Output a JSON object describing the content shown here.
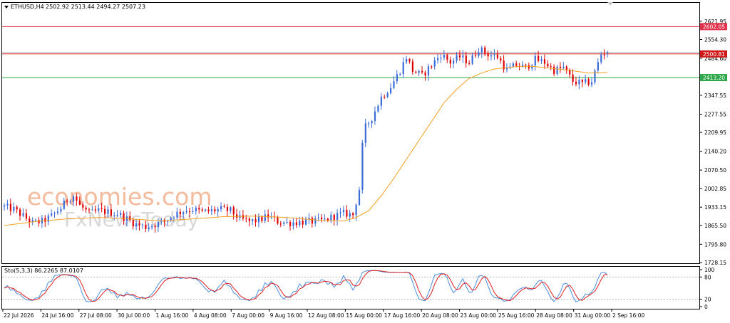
{
  "header": {
    "symbol": "ETHUSD,H4",
    "ohlc": "2502.92 2513.44 2494.27 2507.23",
    "oscillator": "Sto(5,3,3) 86.2265 87.0107"
  },
  "watermark": {
    "line1": "economies.com",
    "line2": "FxNewsToday"
  },
  "colors": {
    "bull": "#3a6cd8",
    "bear": "#e00000",
    "ma": "#f5a020",
    "resistance": "#e0304a",
    "support": "#2ea84a",
    "current": "#d01818",
    "stoch_main": "#4a90e2",
    "stoch_signal": "#e02020",
    "grid_dash": "#b0b0b0"
  },
  "chart_data": [
    {
      "type": "candlestick",
      "title": "ETHUSD,H4",
      "ylim": [
        1728.15,
        2690
      ],
      "y_ticks": [
        "2621.95",
        "2554.30",
        "2484.60",
        "2417.65",
        "2347.55",
        "2277.55",
        "2209.95",
        "2140.20",
        "2070.50",
        "2002.85",
        "1933.15",
        "1865.50",
        "1795.80",
        "1728.15"
      ],
      "x_ticks": [
        "22 Jul 2026",
        "24 Jul 16:00",
        "27 Jul 08:00",
        "30 Jul 00:00",
        "1 Aug 16:00",
        "4 Aug 08:00",
        "7 Aug 00:00",
        "9 Aug 16:00",
        "12 Aug 08:00",
        "15 Aug 00:00",
        "17 Aug 16:00",
        "20 Aug 08:00",
        "23 Aug 00:00",
        "25 Aug 16:00",
        "28 Aug 08:00",
        "31 Aug 00:00",
        "2 Sep 16:00"
      ],
      "levels": [
        {
          "name": "resistance",
          "value": 2602.05,
          "label": "2602.05"
        },
        {
          "name": "current",
          "value": 2500.81,
          "label": "2500.81"
        },
        {
          "name": "support",
          "value": 2413.2,
          "label": "2413.20"
        }
      ],
      "close_keypoints": [
        [
          0,
          1935
        ],
        [
          3,
          1925
        ],
        [
          6,
          1900
        ],
        [
          9,
          1875
        ],
        [
          12,
          1880
        ],
        [
          15,
          1900
        ],
        [
          18,
          1930
        ],
        [
          20,
          1960
        ],
        [
          22,
          1975
        ],
        [
          24,
          1940
        ],
        [
          27,
          1910
        ],
        [
          30,
          1920
        ],
        [
          33,
          1915
        ],
        [
          36,
          1910
        ],
        [
          39,
          1890
        ],
        [
          42,
          1870
        ],
        [
          45,
          1860
        ],
        [
          48,
          1870
        ],
        [
          51,
          1880
        ],
        [
          54,
          1905
        ],
        [
          57,
          1920
        ],
        [
          60,
          1925
        ],
        [
          63,
          1915
        ],
        [
          66,
          1920
        ],
        [
          69,
          1925
        ],
        [
          72,
          1920
        ],
        [
          75,
          1890
        ],
        [
          78,
          1880
        ],
        [
          81,
          1885
        ],
        [
          84,
          1900
        ],
        [
          87,
          1880
        ],
        [
          90,
          1875
        ],
        [
          93,
          1878
        ],
        [
          96,
          1880
        ],
        [
          99,
          1880
        ],
        [
          102,
          1885
        ],
        [
          105,
          1900
        ],
        [
          108,
          1910
        ],
        [
          111,
          1905
        ],
        [
          113,
          2000
        ],
        [
          114,
          2160
        ],
        [
          115,
          2230
        ],
        [
          117,
          2265
        ],
        [
          120,
          2340
        ],
        [
          123,
          2380
        ],
        [
          126,
          2440
        ],
        [
          128,
          2490
        ],
        [
          130,
          2440
        ],
        [
          133,
          2420
        ],
        [
          136,
          2460
        ],
        [
          139,
          2500
        ],
        [
          142,
          2470
        ],
        [
          145,
          2490
        ],
        [
          148,
          2470
        ],
        [
          151,
          2520
        ],
        [
          154,
          2500
        ],
        [
          157,
          2490
        ],
        [
          160,
          2440
        ],
        [
          163,
          2460
        ],
        [
          166,
          2450
        ],
        [
          169,
          2480
        ],
        [
          172,
          2470
        ],
        [
          175,
          2440
        ],
        [
          178,
          2450
        ],
        [
          181,
          2400
        ],
        [
          184,
          2390
        ],
        [
          187,
          2400
        ],
        [
          190,
          2500
        ],
        [
          192,
          2507
        ]
      ],
      "ma_keypoints": [
        [
          0,
          1865
        ],
        [
          10,
          1880
        ],
        [
          20,
          1890
        ],
        [
          30,
          1895
        ],
        [
          40,
          1890
        ],
        [
          50,
          1882
        ],
        [
          60,
          1890
        ],
        [
          70,
          1898
        ],
        [
          80,
          1900
        ],
        [
          90,
          1895
        ],
        [
          100,
          1885
        ],
        [
          108,
          1882
        ],
        [
          112,
          1895
        ],
        [
          116,
          1920
        ],
        [
          120,
          1975
        ],
        [
          124,
          2040
        ],
        [
          128,
          2110
        ],
        [
          132,
          2180
        ],
        [
          136,
          2250
        ],
        [
          140,
          2320
        ],
        [
          144,
          2370
        ],
        [
          148,
          2410
        ],
        [
          152,
          2430
        ],
        [
          156,
          2445
        ],
        [
          160,
          2450
        ],
        [
          164,
          2455
        ],
        [
          168,
          2455
        ],
        [
          172,
          2450
        ],
        [
          176,
          2445
        ],
        [
          180,
          2440
        ],
        [
          186,
          2430
        ],
        [
          192,
          2432
        ]
      ]
    },
    {
      "type": "line",
      "title": "Sto(5,3,3) 86.2265 87.0107",
      "ylim": [
        0,
        100
      ],
      "y_ticks": [
        "100",
        "80",
        "20",
        "0"
      ],
      "series": [
        {
          "key": "main",
          "last": 86.2265
        },
        {
          "key": "signal",
          "last": 87.0107
        }
      ]
    }
  ]
}
